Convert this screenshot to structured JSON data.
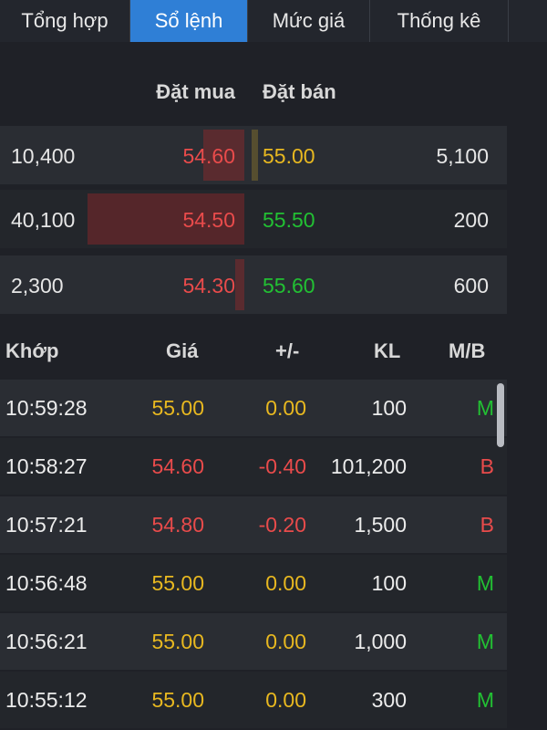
{
  "tabs": [
    {
      "label": "Tổng hợp",
      "active": false
    },
    {
      "label": "Sổ lệnh",
      "active": true
    },
    {
      "label": "Mức giá",
      "active": false
    },
    {
      "label": "Thống kê",
      "active": false
    }
  ],
  "orderbook": {
    "buy_header": "Đặt mua",
    "sell_header": "Đặt bán",
    "rows": [
      {
        "buy_volume": "10,400",
        "buy_price": "54.60",
        "buy_color": "red",
        "sell_price": "55.00",
        "sell_color": "yellow",
        "sell_volume": "5,100",
        "buy_bar_fraction": 0.26,
        "sell_bar_fraction": 0.12
      },
      {
        "buy_volume": "40,100",
        "buy_price": "54.50",
        "buy_color": "red",
        "sell_price": "55.50",
        "sell_color": "green",
        "sell_volume": "200",
        "buy_bar_fraction": 1.0,
        "sell_bar_fraction": 0.0
      },
      {
        "buy_volume": "2,300",
        "buy_price": "54.30",
        "buy_color": "red",
        "sell_price": "55.60",
        "sell_color": "green",
        "sell_volume": "600",
        "buy_bar_fraction": 0.06,
        "sell_bar_fraction": 0.0
      }
    ]
  },
  "matches": {
    "headers": {
      "time": "Khớp",
      "price": "Giá",
      "change": "+/-",
      "volume": "KL",
      "mb": "M/B"
    },
    "rows": [
      {
        "time": "10:59:28",
        "price": "55.00",
        "change": "0.00",
        "volume": "100",
        "mb": "M",
        "price_color": "yellow",
        "mb_color": "green"
      },
      {
        "time": "10:58:27",
        "price": "54.60",
        "change": "-0.40",
        "volume": "101,200",
        "mb": "B",
        "price_color": "red",
        "mb_color": "red"
      },
      {
        "time": "10:57:21",
        "price": "54.80",
        "change": "-0.20",
        "volume": "1,500",
        "mb": "B",
        "price_color": "red",
        "mb_color": "red"
      },
      {
        "time": "10:56:48",
        "price": "55.00",
        "change": "0.00",
        "volume": "100",
        "mb": "M",
        "price_color": "yellow",
        "mb_color": "green"
      },
      {
        "time": "10:56:21",
        "price": "55.00",
        "change": "0.00",
        "volume": "1,000",
        "mb": "M",
        "price_color": "yellow",
        "mb_color": "green"
      },
      {
        "time": "10:55:12",
        "price": "55.00",
        "change": "0.00",
        "volume": "300",
        "mb": "M",
        "price_color": "yellow",
        "mb_color": "green"
      }
    ]
  },
  "colors": {
    "active_tab": "#2f7fd6",
    "red": "#e94b4b",
    "yellow": "#e8b820",
    "green": "#22c033",
    "background": "#1f2127"
  }
}
